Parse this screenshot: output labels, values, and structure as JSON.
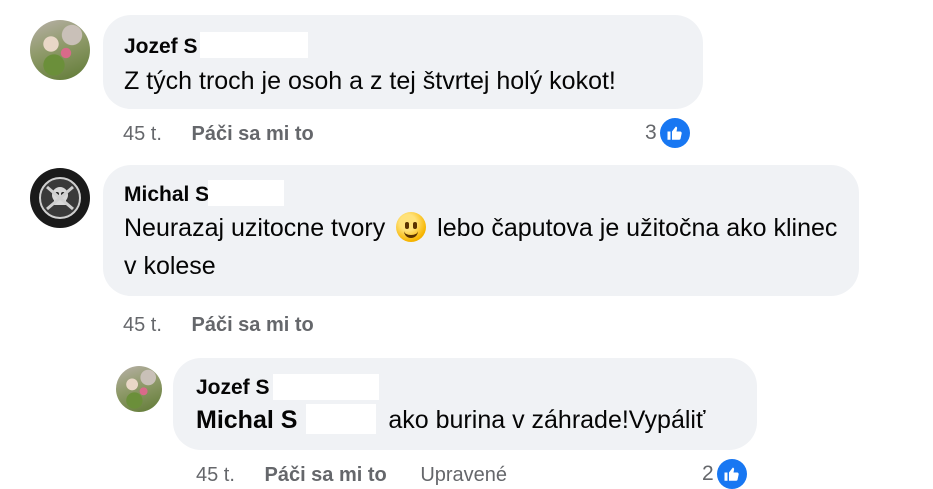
{
  "comments": [
    {
      "author": "Jozef S",
      "text": "Z tých troch je osoh a z tej štvrtej holý kokot!",
      "time": "45 t.",
      "like_label": "Páči sa mi to",
      "reaction_count": "3"
    },
    {
      "author": "Michal S",
      "text_before_emoji": "Neurazaj uzitocne tvory",
      "text_after_emoji": "lebo čaputova je užitočna ako klinec v kolese",
      "time": "45 t.",
      "like_label": "Páči sa mi to"
    },
    {
      "author": "Jozef S",
      "mention": "Michal S",
      "text": "ako burina v záhrade!Vypáliť",
      "time": "45 t.",
      "like_label": "Páči sa mi to",
      "edited_label": "Upravené",
      "reaction_count": "2"
    }
  ],
  "icons": {
    "like": "thumbs-up-icon",
    "emoji": "smiling-face-icon"
  },
  "colors": {
    "bubble": "#f0f2f5",
    "meta": "#65676b",
    "like_blue": "#1877f2"
  }
}
